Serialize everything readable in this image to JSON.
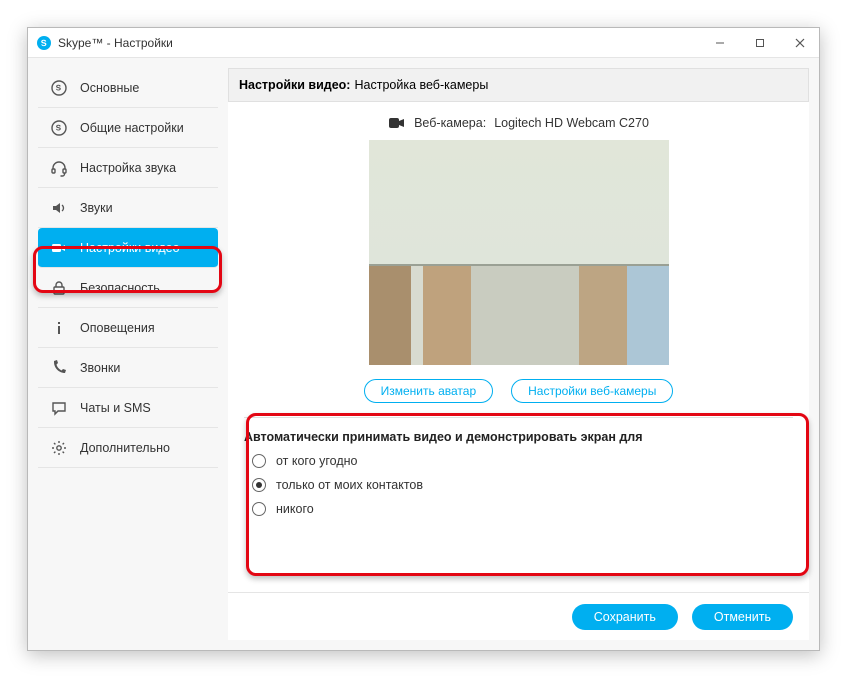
{
  "window": {
    "title": "Skype™ - Настройки"
  },
  "sidebar": {
    "items": [
      {
        "label": "Основные"
      },
      {
        "label": "Общие настройки"
      },
      {
        "label": "Настройка звука"
      },
      {
        "label": "Звуки"
      },
      {
        "label": "Настройки видео"
      },
      {
        "label": "Безопасность"
      },
      {
        "label": "Оповещения"
      },
      {
        "label": "Звонки"
      },
      {
        "label": "Чаты и SMS"
      },
      {
        "label": "Дополнительно"
      }
    ],
    "active_index": 4
  },
  "header": {
    "title_bold": "Настройки видео:",
    "title_rest": "Настройка веб-камеры"
  },
  "webcam": {
    "label": "Веб-камера:",
    "name": "Logitech HD Webcam C270"
  },
  "buttons": {
    "change_avatar": "Изменить аватар",
    "webcam_settings": "Настройки веб-камеры",
    "save": "Сохранить",
    "cancel": "Отменить"
  },
  "auto_accept": {
    "title": "Автоматически принимать видео и демонстрировать экран для",
    "options": [
      {
        "label": "от кого угодно",
        "checked": false
      },
      {
        "label": "только от моих контактов",
        "checked": true
      },
      {
        "label": "никого",
        "checked": false
      }
    ]
  }
}
